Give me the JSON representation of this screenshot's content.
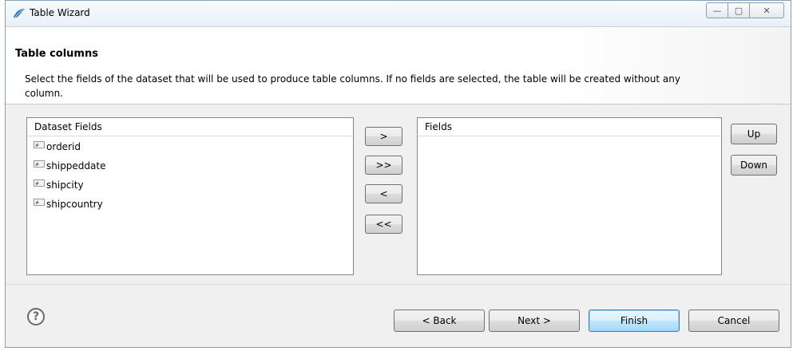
{
  "window": {
    "title": "Table Wizard",
    "minimize_glyph": "—",
    "maximize_glyph": "▢",
    "close_glyph": "✕"
  },
  "header": {
    "title": "Table columns",
    "description": "Select the fields of the dataset that will be used to produce table columns. If no fields are selected, the table will be created without any column."
  },
  "dataset_list": {
    "header": "Dataset Fields",
    "items": [
      {
        "icon": "field-icon",
        "label": "orderid"
      },
      {
        "icon": "field-icon",
        "label": "shippeddate"
      },
      {
        "icon": "field-icon",
        "label": "shipcity"
      },
      {
        "icon": "field-icon",
        "label": "shipcountry"
      }
    ]
  },
  "transfer_buttons": {
    "add": ">",
    "add_all": ">>",
    "remove": "<",
    "remove_all": "<<"
  },
  "fields_list": {
    "header": "Fields",
    "items": []
  },
  "order_buttons": {
    "up": "Up",
    "down": "Down"
  },
  "footer": {
    "help_glyph": "?",
    "back": "< Back",
    "next": "Next >",
    "finish": "Finish",
    "cancel": "Cancel"
  },
  "colors": {
    "default_button": "#a7d9f5",
    "window_border": "#8a9eb8"
  }
}
